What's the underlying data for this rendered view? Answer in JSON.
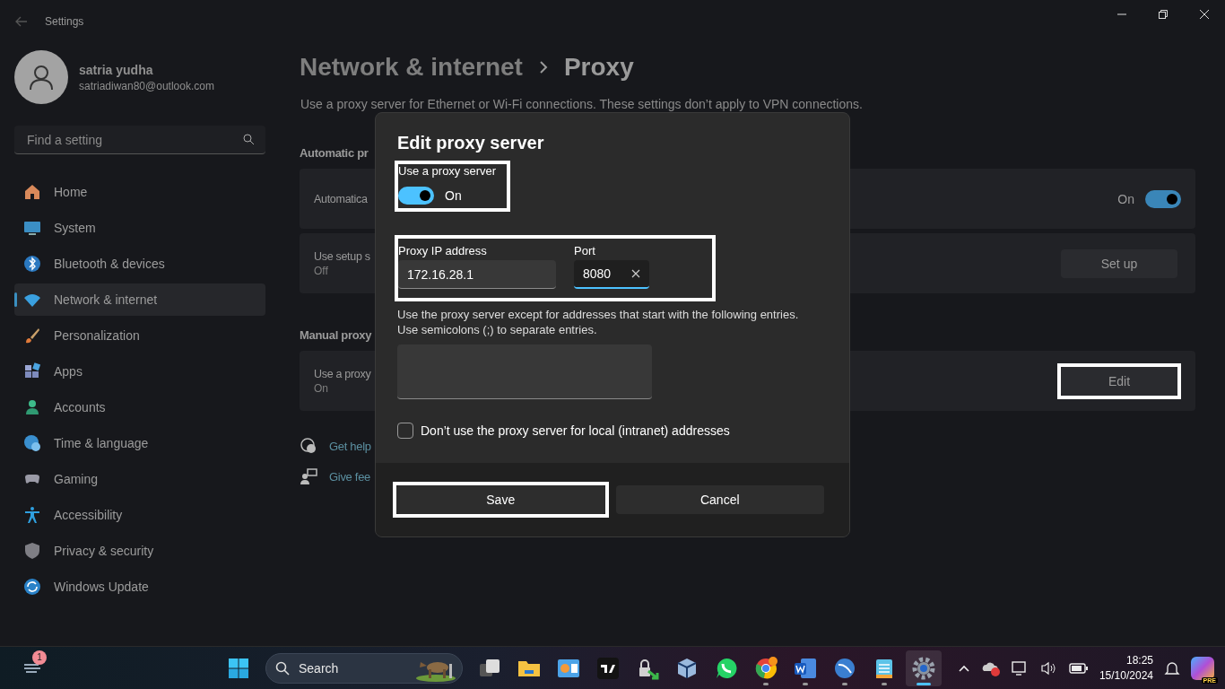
{
  "window": {
    "title": "Settings"
  },
  "profile": {
    "name": "satria yudha",
    "email": "satriadiwan80@outlook.com"
  },
  "search": {
    "placeholder": "Find a setting"
  },
  "nav": [
    {
      "label": "Home",
      "selected": false
    },
    {
      "label": "System",
      "selected": false
    },
    {
      "label": "Bluetooth & devices",
      "selected": false
    },
    {
      "label": "Network & internet",
      "selected": true
    },
    {
      "label": "Personalization",
      "selected": false
    },
    {
      "label": "Apps",
      "selected": false
    },
    {
      "label": "Accounts",
      "selected": false
    },
    {
      "label": "Time & language",
      "selected": false
    },
    {
      "label": "Gaming",
      "selected": false
    },
    {
      "label": "Accessibility",
      "selected": false
    },
    {
      "label": "Privacy & security",
      "selected": false
    },
    {
      "label": "Windows Update",
      "selected": false
    }
  ],
  "breadcrumb": {
    "parent": "Network & internet",
    "current": "Proxy"
  },
  "description": "Use a proxy server for Ethernet or Wi-Fi connections. These settings don’t apply to VPN connections.",
  "sections": [
    {
      "heading": "Automatic pr",
      "cards": [
        {
          "kind": "toggle",
          "title": "Automatica",
          "state_label": "On",
          "on": true
        },
        {
          "kind": "button",
          "title": "Use setup s",
          "subtitle": "Off",
          "button": "Set up",
          "annotated": false
        }
      ]
    },
    {
      "heading": "Manual proxy",
      "cards": [
        {
          "kind": "button",
          "title": "Use a proxy",
          "subtitle": "On",
          "button": "Edit",
          "annotated": true
        }
      ]
    }
  ],
  "help_links": [
    {
      "label": "Get help"
    },
    {
      "label": "Give fee"
    }
  ],
  "dialog": {
    "title": "Edit proxy server",
    "toggle": {
      "label": "Use a proxy server",
      "state_label": "On",
      "on": true,
      "annotated": true
    },
    "address_annotated": true,
    "ip": {
      "label": "Proxy IP address",
      "value": "172.16.28.1"
    },
    "port": {
      "label": "Port",
      "value": "8080",
      "focused": true
    },
    "exceptions_hint": [
      "Use the proxy server except for addresses that start with the following entries.",
      "Use semicolons (;) to separate entries."
    ],
    "local_checkbox": {
      "label": "Don’t use the proxy server for local (intranet) addresses",
      "checked": false
    },
    "buttons": [
      {
        "label": "Save",
        "annotated": true
      },
      {
        "label": "Cancel",
        "annotated": false
      }
    ]
  },
  "taskbar": {
    "widgets_badge": "1",
    "search_label": "Search",
    "apps": [
      {
        "kind": "taskview",
        "running": false,
        "selected": false
      },
      {
        "kind": "explorer",
        "running": false,
        "selected": false
      },
      {
        "kind": "chart",
        "running": false,
        "selected": false
      },
      {
        "kind": "trading",
        "running": false,
        "selected": false
      },
      {
        "kind": "remote",
        "running": false,
        "selected": false
      },
      {
        "kind": "cube",
        "running": false,
        "selected": false
      },
      {
        "kind": "whatsapp",
        "running": false,
        "selected": false
      },
      {
        "kind": "chrome",
        "running": true,
        "selected": false
      },
      {
        "kind": "word",
        "running": true,
        "selected": false
      },
      {
        "kind": "winbox",
        "running": true,
        "selected": false
      },
      {
        "kind": "notepad",
        "running": true,
        "selected": false
      },
      {
        "kind": "settings",
        "running": true,
        "selected": true
      }
    ],
    "time": "18:25",
    "date": "15/10/2024",
    "copilot_badge": "PRE"
  }
}
